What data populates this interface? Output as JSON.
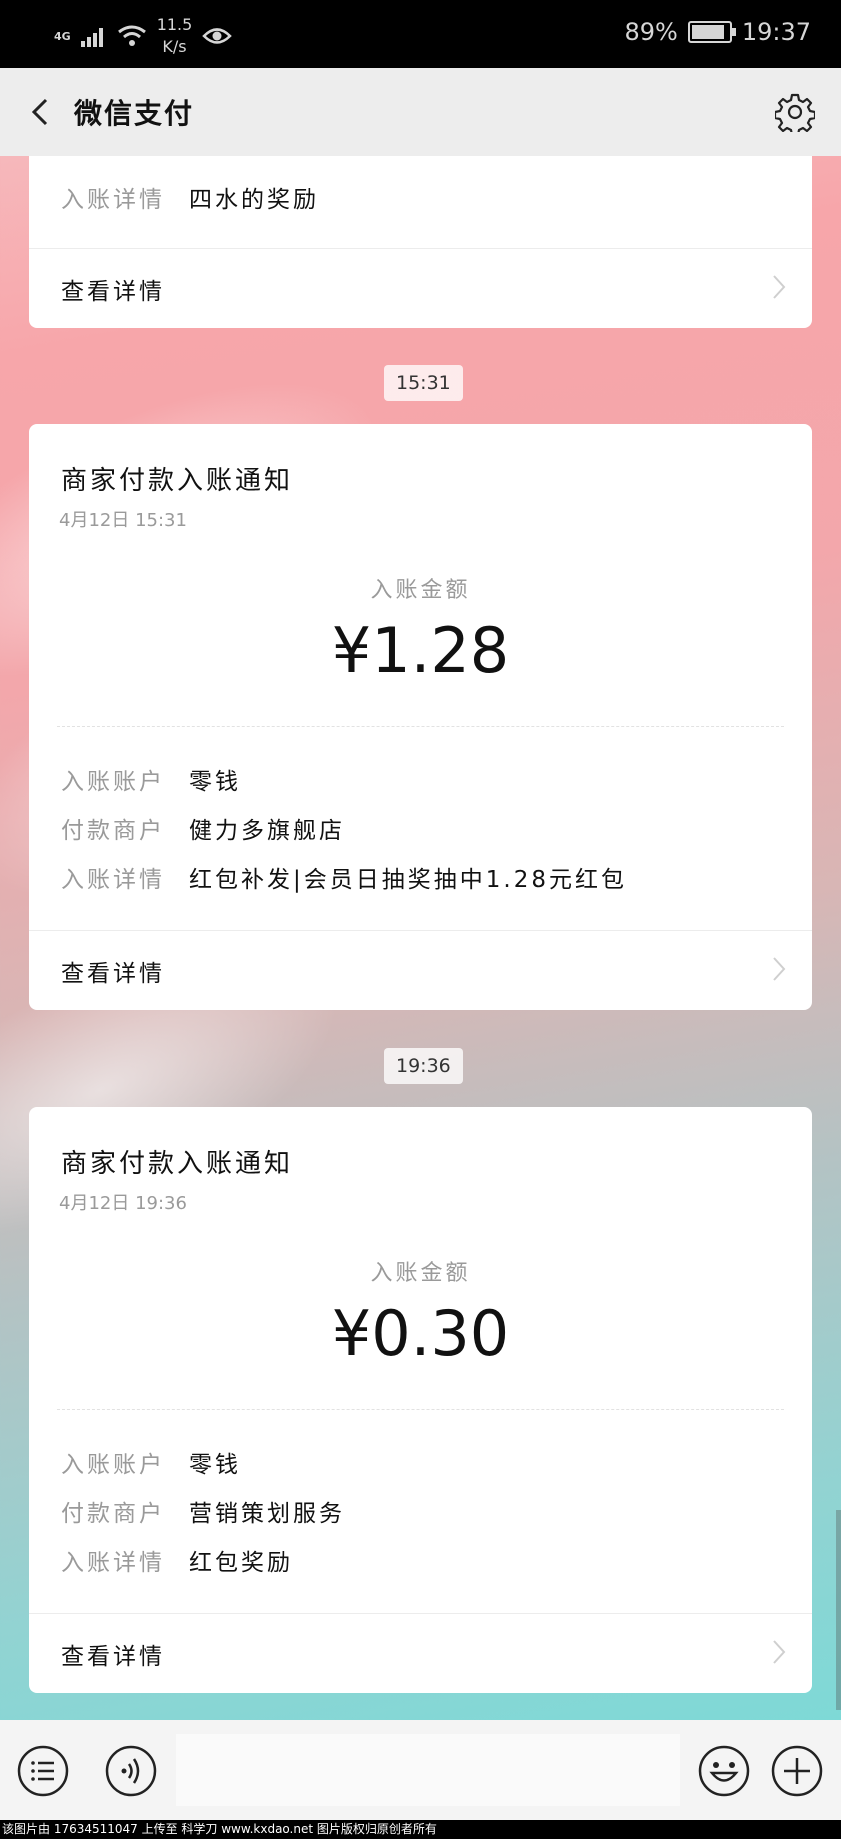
{
  "status_bar": {
    "network": "4G",
    "speed_value": "11.5",
    "speed_unit": "K/s",
    "battery": "89%",
    "battery_level": 0.89,
    "time": "19:37"
  },
  "nav": {
    "title": "微信支付",
    "icons": [
      "back-arrow-icon",
      "gear-icon"
    ]
  },
  "messages": [
    {
      "partial": true,
      "rows": [
        {
          "label": "入账详情",
          "value": "四水的奖励"
        }
      ],
      "detail_label": "查看详情"
    },
    {
      "timestamp": "15:31",
      "title": "商家付款入账通知",
      "date": "4月12日  15:31",
      "amount_label": "入账金额",
      "amount": "¥1.28",
      "rows": [
        {
          "label": "入账账户",
          "value": "零钱"
        },
        {
          "label": "付款商户",
          "value": "健力多旗舰店"
        },
        {
          "label": "入账详情",
          "value": "红包补发|会员日抽奖抽中1.28元红包"
        }
      ],
      "detail_label": "查看详情"
    },
    {
      "timestamp": "19:36",
      "title": "商家付款入账通知",
      "date": "4月12日  19:36",
      "amount_label": "入账金额",
      "amount": "¥0.30",
      "rows": [
        {
          "label": "入账账户",
          "value": "零钱"
        },
        {
          "label": "付款商户",
          "value": "营销策划服务"
        },
        {
          "label": "入账详情",
          "value": "红包奖励"
        }
      ],
      "detail_label": "查看详情"
    }
  ],
  "bottom_bar": {
    "icons": [
      "menu-list-icon",
      "voice-icon",
      "emoji-icon",
      "plus-icon"
    ]
  },
  "footer_text": "该图片由 17634511047 上传至 科学刀 www.kxdao.net 图片版权归原创者所有",
  "colors": {
    "accent_bg_top": "#f7a6aa",
    "accent_bg_bottom": "#74dcd9",
    "label_gray": "#9a9a9a"
  }
}
